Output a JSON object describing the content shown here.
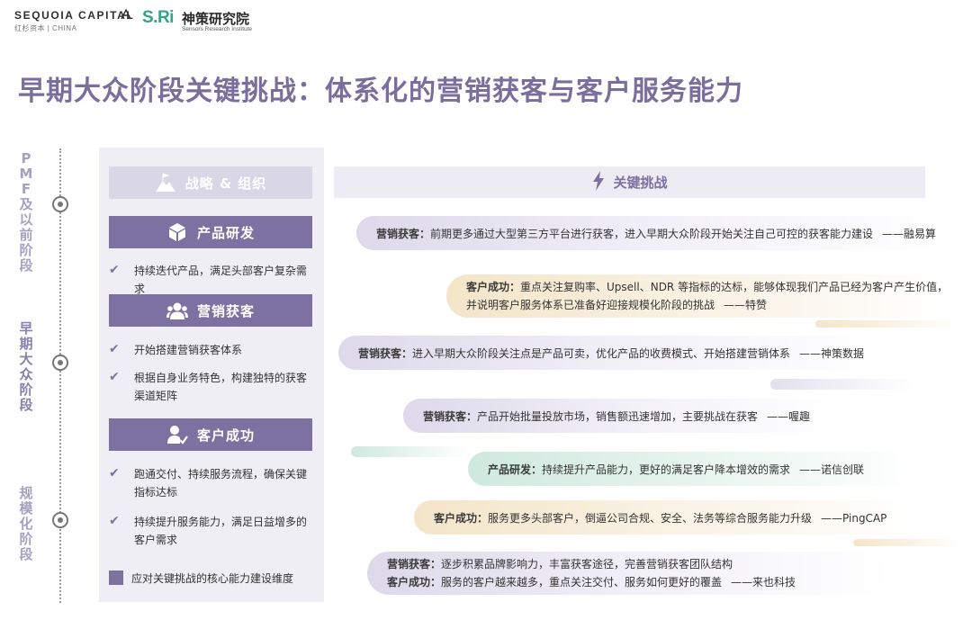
{
  "header": {
    "sequoia_name": "SEQUOIA CAPITAL",
    "sequoia_sub": "红杉资本 | CHINA",
    "sri_logo": "S.Ri",
    "sri_cn": "神策研究院",
    "sri_en": "Sensors Research Institute"
  },
  "title": "早期大众阶段关键挑战：体系化的营销获客与客户服务能力",
  "stages": [
    "PMF及以前阶段",
    "早期大众阶段",
    "规模化阶段"
  ],
  "left": {
    "strategy_label": "战略 & 组织",
    "sections": [
      {
        "label": "产品研发",
        "icon": "cube-icon",
        "items": [
          "持续迭代产品，满足头部客户复杂需求"
        ]
      },
      {
        "label": "营销获客",
        "icon": "users-icon",
        "items": [
          "开始搭建营销获客体系",
          "根据自身业务特色，构建独特的获客渠道矩阵"
        ]
      },
      {
        "label": "客户成功",
        "icon": "user-check-icon",
        "items": [
          "跑通交付、持续服务流程，确保关键指标达标",
          "持续提升服务能力，满足日益增多的客户需求"
        ]
      }
    ],
    "legend": "应对关键挑战的核心能力建设维度"
  },
  "right": {
    "header": "关键挑战",
    "challenges": [
      {
        "key": "营销获客：",
        "text": "前期更多通过大型第三方平台进行获客，进入早期大众阶段开始关注自己可控的获客能力建设",
        "source": "——融易算"
      },
      {
        "key": "客户成功：",
        "text": "重点关注复购率、Upsell、NDR 等指标的达标，能够体现我们产品已经为客户产生价值，",
        "text2": "并说明客户服务体系已准备好迎接规模化阶段的挑战",
        "source": "——特赞"
      },
      {
        "key": "营销获客：",
        "text": "进入早期大众阶段关注点是产品可卖，优化产品的收费模式、开始搭建营销体系",
        "source": "——神策数据"
      },
      {
        "key": "营销获客：",
        "text": "产品开始批量投放市场，销售额迅速增加，主要挑战在获客",
        "source": "——喔趣"
      },
      {
        "key": "产品研发：",
        "text": "持续提升产品能力，更好的满足客户降本增效的需求",
        "source": "——诺信创联"
      },
      {
        "key": "客户成功：",
        "text": "服务更多头部客户，倒逼公司合规、安全、法务等综合服务能力升级",
        "source": "——PingCAP"
      },
      {
        "key": "营销获客：",
        "text": "逐步积累品牌影响力，丰富获客途径，完善营销获客团队结构",
        "key2": "客户成功：",
        "text2": "服务的客户越来越多，重点关注交付、服务如何更好的覆盖",
        "source": "——来也科技"
      }
    ]
  },
  "colors": {
    "title": "#7a6e9c",
    "bar_dark": "#7d71a1",
    "bar_light": "#d9d6e5",
    "purple_pill": "#ddd9eb",
    "gold_pill": "#f3e5c8",
    "green_pill": "#cfe9df"
  }
}
